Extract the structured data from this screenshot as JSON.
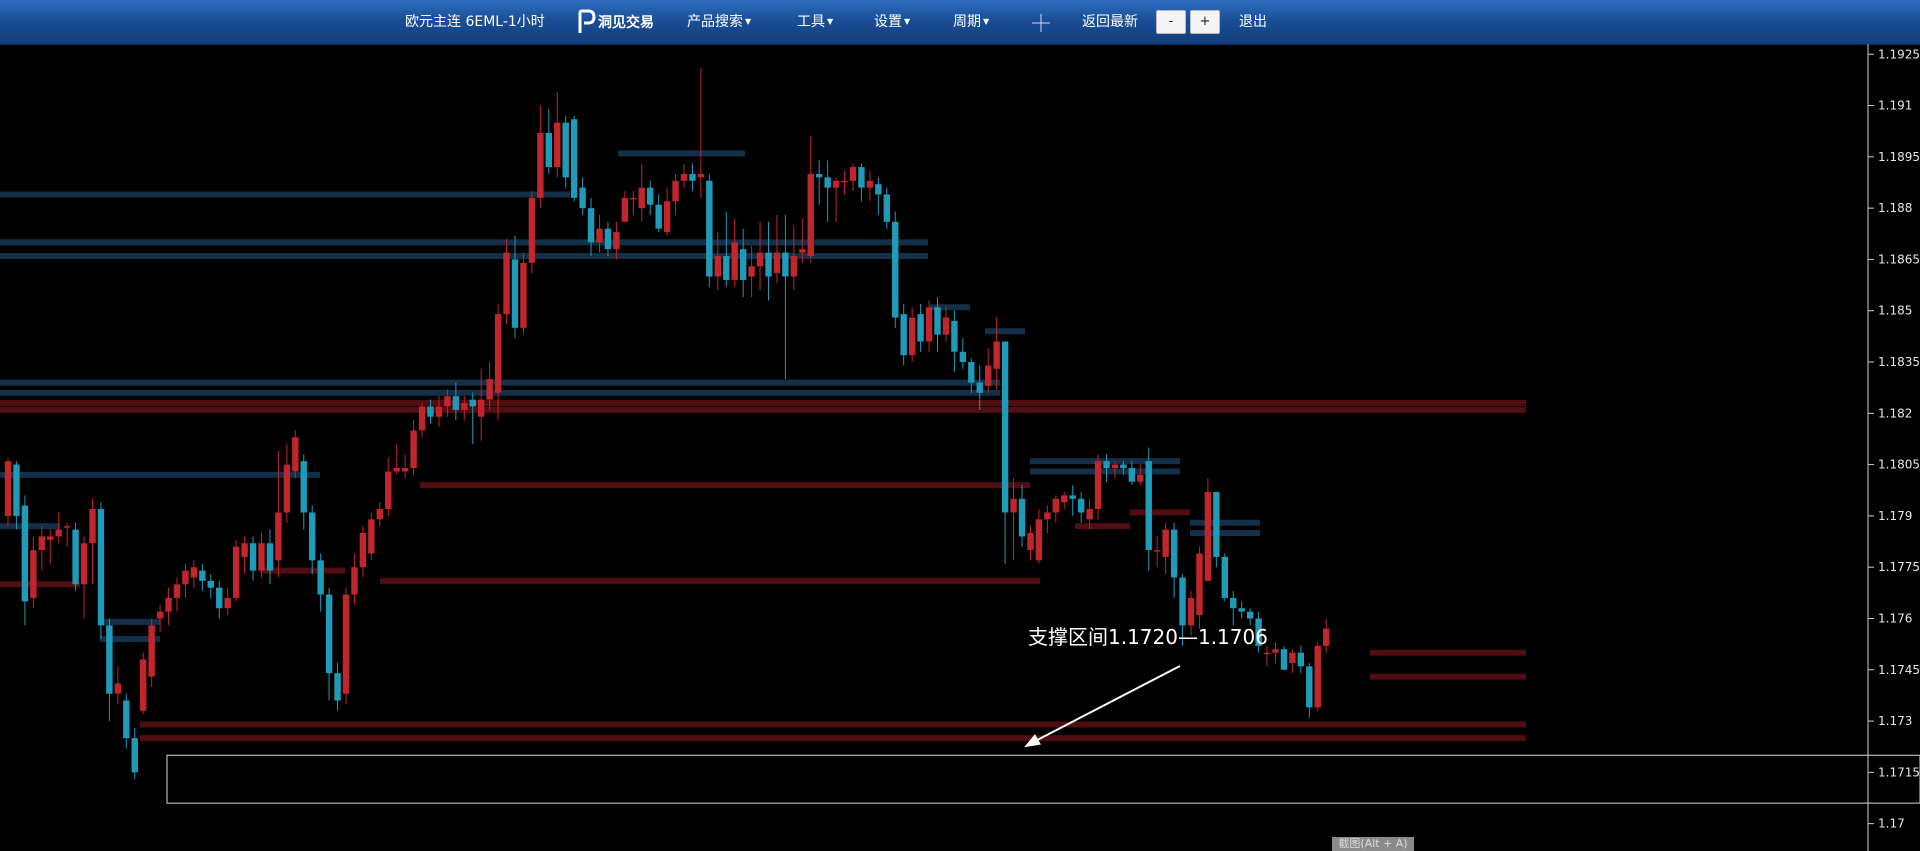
{
  "toolbar": {
    "title": "欧元主连 6EML-1小时",
    "logo_text": "洞见交易",
    "logo_icon": "p-logo-icon",
    "product_search": "产品搜索",
    "tools": "工具",
    "settings": "设置",
    "period": "周期",
    "crosshair_icon": "crosshair-icon",
    "back_latest": "返回最新",
    "zoom_out": "-",
    "zoom_in": "+",
    "exit": "退出"
  },
  "hint": "截图(Alt + A)",
  "colors": {
    "up": "#c0262b",
    "down": "#1f9ab8",
    "resistance_line": "#5a0f14",
    "support_line": "#163550",
    "background": "#000000"
  },
  "chart_data": {
    "type": "candlestick",
    "title": "",
    "ylim": [
      1.1692,
      1.1928
    ],
    "y_ticks": [
      "1.1925",
      "1.191",
      "1.1895",
      "1.188",
      "1.1865",
      "1.185",
      "1.1835",
      "1.182",
      "1.1805",
      "1.179",
      "1.1775",
      "1.176",
      "1.1745",
      "1.173",
      "1.1715",
      "1.17"
    ],
    "annotation": {
      "text": "支撑区间1.1720—1.1706",
      "zone": [
        1.1706,
        1.172
      ],
      "arrow_to": [
        1025,
        1.172
      ]
    },
    "levels": [
      {
        "type": "support",
        "y": 1.1884,
        "x0": 0,
        "x1": 570
      },
      {
        "type": "support",
        "y": 1.187,
        "x0": 0,
        "x1": 928
      },
      {
        "type": "support",
        "y": 1.1866,
        "x0": 0,
        "x1": 928
      },
      {
        "type": "support",
        "y": 1.1896,
        "x0": 618,
        "x1": 745
      },
      {
        "type": "support",
        "y": 1.1829,
        "x0": 0,
        "x1": 1000
      },
      {
        "type": "support",
        "y": 1.1826,
        "x0": 0,
        "x1": 1000
      },
      {
        "type": "resistance",
        "y": 1.1823,
        "x0": 0,
        "x1": 1526
      },
      {
        "type": "resistance",
        "y": 1.1821,
        "x0": 0,
        "x1": 1526
      },
      {
        "type": "support",
        "y": 1.1802,
        "x0": 0,
        "x1": 320
      },
      {
        "type": "support",
        "y": 1.1787,
        "x0": 0,
        "x1": 60
      },
      {
        "type": "resistance",
        "y": 1.177,
        "x0": 0,
        "x1": 80
      },
      {
        "type": "resistance",
        "y": 1.1774,
        "x0": 260,
        "x1": 345
      },
      {
        "type": "resistance",
        "y": 1.1799,
        "x0": 420,
        "x1": 1030
      },
      {
        "type": "resistance",
        "y": 1.1771,
        "x0": 380,
        "x1": 1040
      },
      {
        "type": "support",
        "y": 1.1759,
        "x0": 100,
        "x1": 160
      },
      {
        "type": "support",
        "y": 1.1754,
        "x0": 100,
        "x1": 160
      },
      {
        "type": "support",
        "y": 1.1806,
        "x0": 1030,
        "x1": 1180
      },
      {
        "type": "support",
        "y": 1.1803,
        "x0": 1030,
        "x1": 1180
      },
      {
        "type": "resistance",
        "y": 1.1787,
        "x0": 1075,
        "x1": 1130
      },
      {
        "type": "resistance",
        "y": 1.1791,
        "x0": 1130,
        "x1": 1190
      },
      {
        "type": "support",
        "y": 1.1788,
        "x0": 1190,
        "x1": 1260
      },
      {
        "type": "support",
        "y": 1.1785,
        "x0": 1190,
        "x1": 1260
      },
      {
        "type": "support",
        "y": 1.1851,
        "x0": 930,
        "x1": 970
      },
      {
        "type": "support",
        "y": 1.1844,
        "x0": 985,
        "x1": 1025
      },
      {
        "type": "resistance",
        "y": 1.175,
        "x0": 1370,
        "x1": 1526
      },
      {
        "type": "resistance",
        "y": 1.1743,
        "x0": 1370,
        "x1": 1526
      },
      {
        "type": "resistance",
        "y": 1.1729,
        "x0": 140,
        "x1": 1526
      },
      {
        "type": "resistance",
        "y": 1.1725,
        "x0": 140,
        "x1": 1526
      }
    ],
    "candles": [
      [
        1.179,
        1.1806,
        1.1787,
        1.1807
      ],
      [
        1.1805,
        1.179,
        1.1786,
        1.1806
      ],
      [
        1.1793,
        1.1765,
        1.1758,
        1.1796
      ],
      [
        1.1766,
        1.178,
        1.1763,
        1.1784
      ],
      [
        1.178,
        1.1784,
        1.1774,
        1.1787
      ],
      [
        1.1783,
        1.1784,
        1.1776,
        1.1786
      ],
      [
        1.1784,
        1.1786,
        1.1782,
        1.1791
      ],
      [
        1.1787,
        1.1787,
        1.1781,
        1.1788
      ],
      [
        1.1786,
        1.177,
        1.1768,
        1.1788
      ],
      [
        1.177,
        1.1782,
        1.176,
        1.1784
      ],
      [
        1.1782,
        1.1792,
        1.177,
        1.1795
      ],
      [
        1.1792,
        1.1758,
        1.1754,
        1.1794
      ],
      [
        1.1758,
        1.1738,
        1.173,
        1.176
      ],
      [
        1.1738,
        1.1741,
        1.1735,
        1.1746
      ],
      [
        1.1736,
        1.1725,
        1.1722,
        1.1738
      ],
      [
        1.1725,
        1.1715,
        1.1713,
        1.1728
      ],
      [
        1.1733,
        1.1748,
        1.1732,
        1.175
      ],
      [
        1.1743,
        1.1758,
        1.174,
        1.176
      ],
      [
        1.176,
        1.1762,
        1.1756,
        1.1764
      ],
      [
        1.1762,
        1.1766,
        1.1758,
        1.1769
      ],
      [
        1.1766,
        1.177,
        1.1762,
        1.1772
      ],
      [
        1.177,
        1.1774,
        1.1766,
        1.1776
      ],
      [
        1.1772,
        1.1775,
        1.1769,
        1.1777
      ],
      [
        1.1774,
        1.1771,
        1.1768,
        1.1776
      ],
      [
        1.1771,
        1.1769,
        1.1766,
        1.1773
      ],
      [
        1.1769,
        1.1763,
        1.176,
        1.1771
      ],
      [
        1.1763,
        1.1766,
        1.1761,
        1.1769
      ],
      [
        1.1766,
        1.1781,
        1.1765,
        1.1783
      ],
      [
        1.1778,
        1.1782,
        1.1773,
        1.1784
      ],
      [
        1.1782,
        1.1774,
        1.1771,
        1.1784
      ],
      [
        1.1774,
        1.1782,
        1.1772,
        1.1785
      ],
      [
        1.1782,
        1.1774,
        1.177,
        1.1786
      ],
      [
        1.1777,
        1.1791,
        1.1772,
        1.1809
      ],
      [
        1.1791,
        1.1805,
        1.1788,
        1.1811
      ],
      [
        1.1803,
        1.1813,
        1.1801,
        1.1815
      ],
      [
        1.1806,
        1.1791,
        1.1786,
        1.1808
      ],
      [
        1.1791,
        1.1777,
        1.1773,
        1.1793
      ],
      [
        1.1777,
        1.1767,
        1.1762,
        1.1779
      ],
      [
        1.1767,
        1.1744,
        1.1736,
        1.1769
      ],
      [
        1.1744,
        1.1736,
        1.1733,
        1.1747
      ],
      [
        1.1738,
        1.1767,
        1.1735,
        1.1769
      ],
      [
        1.1767,
        1.1775,
        1.1764,
        1.1779
      ],
      [
        1.1775,
        1.1785,
        1.1772,
        1.1787
      ],
      [
        1.1779,
        1.1789,
        1.1777,
        1.1791
      ],
      [
        1.1789,
        1.1792,
        1.1787,
        1.1794
      ],
      [
        1.1792,
        1.1803,
        1.179,
        1.1807
      ],
      [
        1.1803,
        1.1804,
        1.1802,
        1.1811
      ],
      [
        1.1803,
        1.1804,
        1.1801,
        1.1808
      ],
      [
        1.1804,
        1.1815,
        1.1802,
        1.1818
      ],
      [
        1.1815,
        1.1822,
        1.1813,
        1.1823
      ],
      [
        1.1822,
        1.1819,
        1.1817,
        1.1824
      ],
      [
        1.1819,
        1.1822,
        1.1816,
        1.1825
      ],
      [
        1.1822,
        1.1825,
        1.1819,
        1.1827
      ],
      [
        1.1825,
        1.1821,
        1.1818,
        1.1829
      ],
      [
        1.1821,
        1.1823,
        1.1818,
        1.1825
      ],
      [
        1.1824,
        1.1822,
        1.1811,
        1.1826
      ],
      [
        1.1819,
        1.1824,
        1.1812,
        1.1833
      ],
      [
        1.1824,
        1.183,
        1.1821,
        1.1835
      ],
      [
        1.1826,
        1.1849,
        1.1818,
        1.1852
      ],
      [
        1.1849,
        1.1867,
        1.1846,
        1.1871
      ],
      [
        1.1865,
        1.1845,
        1.1842,
        1.1872
      ],
      [
        1.1845,
        1.1864,
        1.1843,
        1.1867
      ],
      [
        1.1864,
        1.1883,
        1.1861,
        1.1885
      ],
      [
        1.1883,
        1.1902,
        1.188,
        1.191
      ],
      [
        1.1902,
        1.1892,
        1.189,
        1.1909
      ],
      [
        1.1892,
        1.1905,
        1.1889,
        1.1914
      ],
      [
        1.1905,
        1.1889,
        1.1886,
        1.1907
      ],
      [
        1.1906,
        1.1883,
        1.1882,
        1.1907
      ],
      [
        1.1886,
        1.188,
        1.1878,
        1.1889
      ],
      [
        1.188,
        1.187,
        1.1866,
        1.1883
      ],
      [
        1.187,
        1.1874,
        1.1867,
        1.1878
      ],
      [
        1.1874,
        1.1868,
        1.1866,
        1.1876
      ],
      [
        1.1868,
        1.1873,
        1.1865,
        1.1876
      ],
      [
        1.1876,
        1.1883,
        1.1876,
        1.1885
      ],
      [
        1.1883,
        1.1883,
        1.1878,
        1.1885
      ],
      [
        1.188,
        1.1886,
        1.1876,
        1.1893
      ],
      [
        1.1886,
        1.1881,
        1.1878,
        1.1888
      ],
      [
        1.1881,
        1.1874,
        1.1873,
        1.1884
      ],
      [
        1.1873,
        1.1882,
        1.1872,
        1.1886
      ],
      [
        1.1882,
        1.1888,
        1.1878,
        1.189
      ],
      [
        1.1888,
        1.189,
        1.1886,
        1.1893
      ],
      [
        1.189,
        1.1888,
        1.1885,
        1.1893
      ],
      [
        1.1889,
        1.189,
        1.1883,
        1.1921
      ],
      [
        1.1888,
        1.186,
        1.1857,
        1.189
      ],
      [
        1.186,
        1.1866,
        1.1856,
        1.1873
      ],
      [
        1.1866,
        1.1859,
        1.1857,
        1.1879
      ],
      [
        1.1859,
        1.187,
        1.1857,
        1.1877
      ],
      [
        1.1868,
        1.1859,
        1.1854,
        1.1874
      ],
      [
        1.186,
        1.1863,
        1.1854,
        1.1869
      ],
      [
        1.1863,
        1.1867,
        1.1856,
        1.1876
      ],
      [
        1.1867,
        1.186,
        1.1853,
        1.1876
      ],
      [
        1.1861,
        1.1867,
        1.1858,
        1.1878
      ],
      [
        1.1867,
        1.186,
        1.183,
        1.1878
      ],
      [
        1.186,
        1.1866,
        1.1856,
        1.1875
      ],
      [
        1.1867,
        1.1868,
        1.1864,
        1.1877
      ],
      [
        1.1866,
        1.189,
        1.1864,
        1.1901
      ],
      [
        1.189,
        1.1889,
        1.1881,
        1.1894
      ],
      [
        1.1889,
        1.1886,
        1.1876,
        1.1894
      ],
      [
        1.1886,
        1.1888,
        1.1876,
        1.1889
      ],
      [
        1.1888,
        1.1888,
        1.1884,
        1.1891
      ],
      [
        1.1888,
        1.1892,
        1.1885,
        1.1893
      ],
      [
        1.1892,
        1.1886,
        1.1882,
        1.1893
      ],
      [
        1.1886,
        1.1888,
        1.1882,
        1.1891
      ],
      [
        1.1887,
        1.1884,
        1.1878,
        1.1889
      ],
      [
        1.1884,
        1.1876,
        1.1874,
        1.1886
      ],
      [
        1.1876,
        1.1848,
        1.1845,
        1.1879
      ],
      [
        1.1849,
        1.1837,
        1.1834,
        1.1852
      ],
      [
        1.1837,
        1.1848,
        1.1835,
        1.1851
      ],
      [
        1.1849,
        1.1841,
        1.1838,
        1.1852
      ],
      [
        1.1841,
        1.1851,
        1.1838,
        1.1853
      ],
      [
        1.1851,
        1.1843,
        1.1838,
        1.1854
      ],
      [
        1.1843,
        1.1848,
        1.1841,
        1.1851
      ],
      [
        1.1847,
        1.1838,
        1.1832,
        1.185
      ],
      [
        1.1838,
        1.1835,
        1.1833,
        1.1842
      ],
      [
        1.1835,
        1.1829,
        1.1826,
        1.1836
      ],
      [
        1.1829,
        1.1826,
        1.1821,
        1.1834
      ],
      [
        1.1828,
        1.1834,
        1.1826,
        1.1839
      ],
      [
        1.1833,
        1.1841,
        1.1827,
        1.1848
      ],
      [
        1.1841,
        1.1791,
        1.1776,
        1.1841
      ],
      [
        1.1791,
        1.1795,
        1.1777,
        1.1801
      ],
      [
        1.1795,
        1.1784,
        1.1781,
        1.1799
      ],
      [
        1.178,
        1.1785,
        1.1777,
        1.1787
      ],
      [
        1.1777,
        1.1789,
        1.1776,
        1.1792
      ],
      [
        1.1789,
        1.1791,
        1.1785,
        1.1793
      ],
      [
        1.1791,
        1.1795,
        1.1788,
        1.1796
      ],
      [
        1.1794,
        1.1796,
        1.1792,
        1.1797
      ],
      [
        1.1796,
        1.1795,
        1.179,
        1.1799
      ],
      [
        1.1795,
        1.1791,
        1.1788,
        1.1797
      ],
      [
        1.1789,
        1.1792,
        1.1786,
        1.1795
      ],
      [
        1.1792,
        1.1806,
        1.1789,
        1.1808
      ],
      [
        1.1806,
        1.1804,
        1.18,
        1.1808
      ],
      [
        1.1804,
        1.1805,
        1.1801,
        1.1806
      ],
      [
        1.1805,
        1.1804,
        1.1802,
        1.1806
      ],
      [
        1.1804,
        1.18,
        1.1799,
        1.1806
      ],
      [
        1.18,
        1.1802,
        1.1799,
        1.1805
      ],
      [
        1.1806,
        1.178,
        1.1774,
        1.181
      ],
      [
        1.178,
        1.178,
        1.1775,
        1.1784
      ],
      [
        1.1778,
        1.1786,
        1.1773,
        1.1788
      ],
      [
        1.1786,
        1.1772,
        1.1766,
        1.1788
      ],
      [
        1.1772,
        1.1758,
        1.1752,
        1.1773
      ],
      [
        1.1758,
        1.1766,
        1.1755,
        1.1768
      ],
      [
        1.1761,
        1.1779,
        1.1757,
        1.1781
      ],
      [
        1.1771,
        1.1797,
        1.1771,
        1.1801
      ],
      [
        1.1797,
        1.1778,
        1.1775,
        1.1797
      ],
      [
        1.1778,
        1.1766,
        1.1765,
        1.1779
      ],
      [
        1.1766,
        1.1763,
        1.1758,
        1.1768
      ],
      [
        1.1763,
        1.1762,
        1.176,
        1.1765
      ],
      [
        1.1762,
        1.176,
        1.1758,
        1.1763
      ],
      [
        1.176,
        1.1752,
        1.175,
        1.1762
      ],
      [
        1.175,
        1.175,
        1.1746,
        1.1752
      ],
      [
        1.175,
        1.1751,
        1.1747,
        1.1753
      ],
      [
        1.1751,
        1.1745,
        1.1745,
        1.1752
      ],
      [
        1.1747,
        1.175,
        1.1744,
        1.1751
      ],
      [
        1.175,
        1.1746,
        1.1744,
        1.1752
      ],
      [
        1.1746,
        1.1734,
        1.1731,
        1.1747
      ],
      [
        1.1734,
        1.1752,
        1.1733,
        1.1753
      ],
      [
        1.1752,
        1.1757,
        1.175,
        1.176
      ]
    ]
  }
}
